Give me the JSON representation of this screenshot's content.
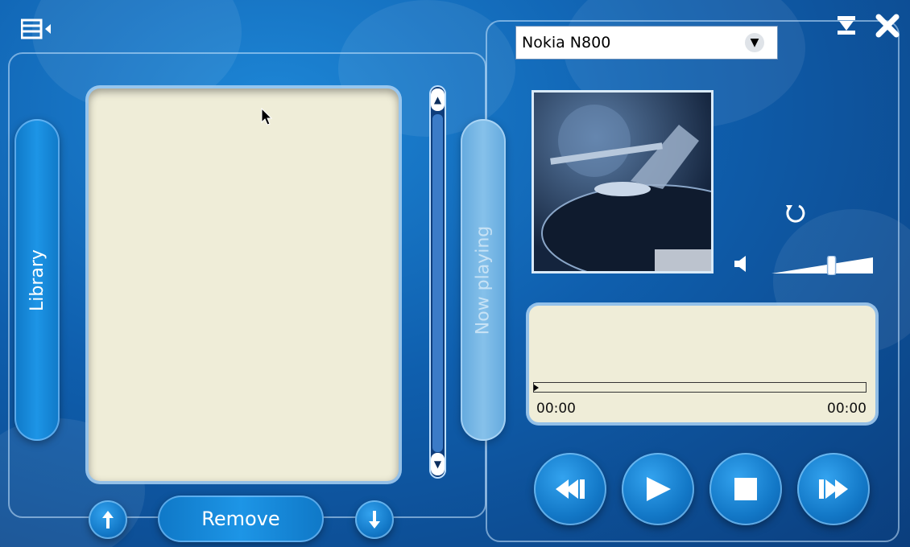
{
  "header": {
    "menu_icon": "playlist-menu-icon",
    "minimize_icon": "minimize-icon",
    "close_icon": "close-icon"
  },
  "sidebar": {
    "library_label": "Library",
    "now_playing_label": "Now playing"
  },
  "playlist": {
    "items": [],
    "remove_label": "Remove",
    "move_up_icon": "arrow-up-icon",
    "move_down_icon": "arrow-down-icon"
  },
  "player": {
    "device": "Nokia N800",
    "repeat_icon": "repeat-icon",
    "volume_icon": "speaker-icon",
    "volume_level": 0.6,
    "progress": 0,
    "elapsed": "00:00",
    "duration": "00:00",
    "controls": {
      "previous_icon": "skip-back-icon",
      "play_icon": "play-icon",
      "stop_icon": "stop-icon",
      "next_icon": "skip-forward-icon"
    }
  },
  "colors": {
    "background": "#0f5fae",
    "panel": "#efedd8",
    "accent": "#1d95e6"
  }
}
